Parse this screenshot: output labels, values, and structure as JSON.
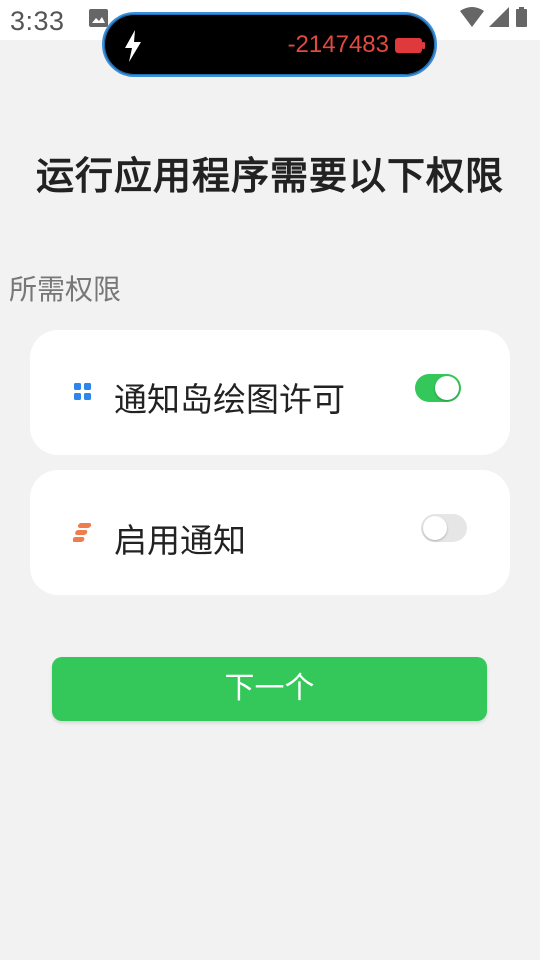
{
  "status_bar": {
    "time": "3:33",
    "icons": [
      "image-icon",
      "wifi-icon",
      "signal-icon",
      "battery-icon"
    ]
  },
  "island": {
    "icon": "lightning-bolt-icon",
    "value": "-2147483",
    "battery_icon": "battery-low-icon",
    "value_color": "#e14a40"
  },
  "page": {
    "title": "运行应用程序需要以下权限",
    "section_label": "所需权限"
  },
  "permissions": [
    {
      "label": "通知岛绘图许可",
      "icon": "grid-dots-icon",
      "enabled": true
    },
    {
      "label": "启用通知",
      "icon": "stripes-icon",
      "enabled": false
    }
  ],
  "actions": {
    "next_label": "下一个"
  },
  "colors": {
    "accent": "#34c759",
    "background": "#f2f2f2",
    "card": "#ffffff"
  }
}
